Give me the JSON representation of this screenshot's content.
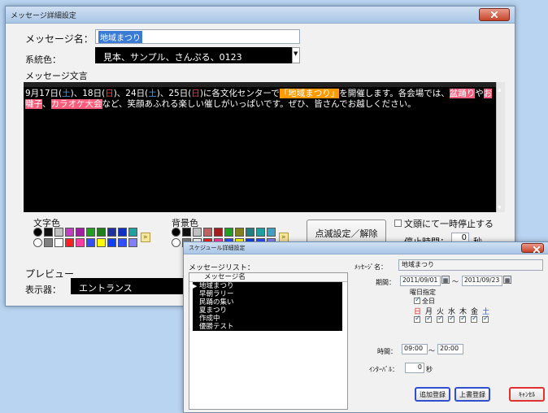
{
  "main_window": {
    "title": "メッセージ詳細設定",
    "message_name_label": "メッセージ名：",
    "message_name_value": "地域まつり",
    "system_color_label": "系統色：",
    "system_color_value": "見本、サンプル、さんぷる、0123",
    "message_text_label": "メッセージ文言",
    "message_parts": {
      "p1": "9月17日(",
      "p1_day": "土",
      "p2": ")、18日(",
      "p2_day": "日",
      "p3": ")、24日(",
      "p3_day": "土",
      "p4": ")、25日(",
      "p4_day": "日",
      "p5": ")に各文化センターで",
      "p5_hl": "「地域まつり」",
      "p6": "を開催します。各会場では、",
      "p6_hl": "盆踊り",
      "p7": "や",
      "p7_hl": "お囃子",
      "p8": "、",
      "p8_hl": "カラオケ大会",
      "p9": "など、笑顔あふれる楽しい催しがいっぱいです。ぜひ、皆さんでお越しください。"
    },
    "text_color_label": "文字色",
    "bg_color_label": "背景色",
    "blink_button": "点滅設定／解除",
    "pause_checkbox_label": "文頭にて一時停止する",
    "stop_time_label": "停止時間：",
    "stop_time_value": "0",
    "stop_time_unit": "秒",
    "preview_label": "プレビュー",
    "display_label": "表示器：",
    "display_value": "エントランス"
  },
  "schedule_window": {
    "title": "スケジュール詳細設定",
    "message_list_label": "メッセージリスト：",
    "list_header": "メッセージ名",
    "list_items": [
      "地域まつり",
      "早朝ラリー",
      "民踊の集い",
      "夏まつり",
      "作成中",
      "優勝テスト"
    ],
    "message_name_label": "ﾒｯｾｰｼﾞ名：",
    "message_name_value": "地域まつり",
    "period_label": "期間：",
    "period_from": "2011/09/01",
    "period_sep": "～",
    "period_to": "2011/09/23",
    "weekday_label": "曜日指定",
    "all_days_label": "全日",
    "days": [
      "日",
      "月",
      "火",
      "水",
      "木",
      "金",
      "土"
    ],
    "time_label": "時間：",
    "time_from": "09:00",
    "time_sep": "～",
    "time_to": "20:00",
    "interval_label": "ｲﾝﾀｰﾊﾞﾙ：",
    "interval_value": "0",
    "interval_unit": "秒",
    "add_button": "追加登録",
    "overwrite_button": "上書登録",
    "cancel_button": "ｷｬﾝｾﾙ"
  },
  "colors": {
    "text_palette_row1": [
      "#000000",
      "#111111",
      "#c0c0c0",
      "#c040c0",
      "#a020a0",
      "#20a020",
      "#208020",
      "#2030a0",
      "#1030c0",
      "#20a0a0"
    ],
    "text_palette_row2": [
      "#ffffff",
      "#808080",
      "#ffffff",
      "#ff2020",
      "#ff40a0",
      "#3050ff",
      "#ffff00",
      "#1040ff",
      "#3050ff",
      "#8080ff"
    ],
    "bg_palette_row1": [
      "#000000",
      "#111111",
      "#c0c0c0",
      "#c06060",
      "#a02020",
      "#20a020",
      "#808020",
      "#208080",
      "#20a0a0",
      "#40a0c0"
    ],
    "bg_palette_row2": [
      "#ffffff",
      "#808080",
      "#ffffff",
      "#ff2020",
      "#ff40a0",
      "#3050ff",
      "#ffff00",
      "#1040ff",
      "#3050ff",
      "#8080ff"
    ]
  }
}
